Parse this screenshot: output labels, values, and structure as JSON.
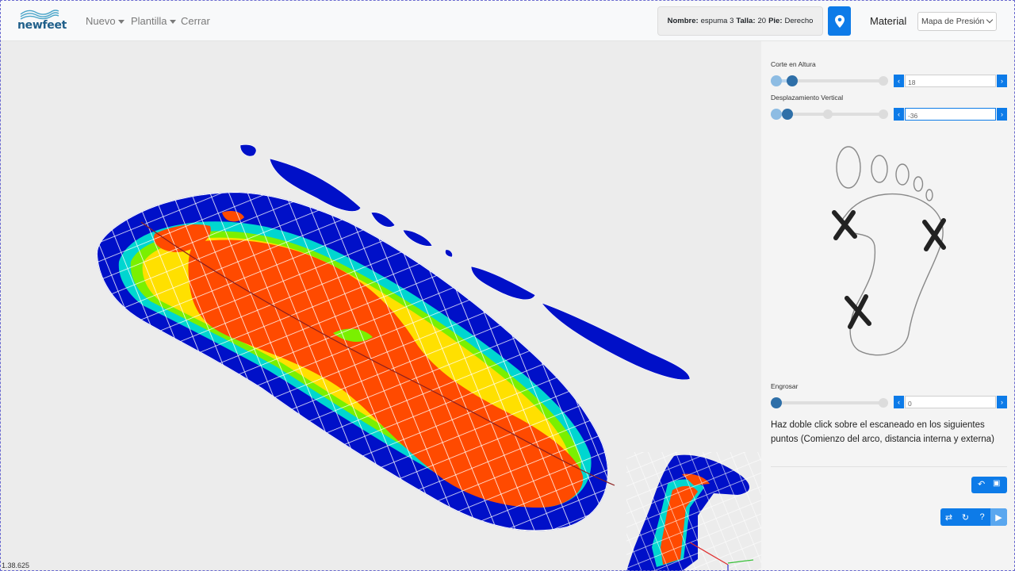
{
  "app": {
    "logo_text": "newfeet",
    "version": "1.38.625"
  },
  "nav": {
    "items": [
      {
        "label": "Nuevo"
      },
      {
        "label": "Plantilla"
      },
      {
        "label": "Cerrar"
      }
    ]
  },
  "info": {
    "nombre_label": "Nombre:",
    "nombre_value": "espuma 3",
    "talla_label": "Talla:",
    "talla_value": "20",
    "pie_label": "Pie:",
    "pie_value": "Derecho"
  },
  "material": {
    "label": "Material",
    "selected": "Mapa de Presión"
  },
  "controls": {
    "corte": {
      "label": "Corte en Altura",
      "value": "18"
    },
    "desplazamiento": {
      "label": "Desplazamiento Vertical",
      "value": "-36"
    },
    "engrosar": {
      "label": "Engrosar",
      "value": "0"
    }
  },
  "instruction": "Haz doble click sobre el escaneado en los siguientes puntos (Comienzo del arco, distancia interna y externa)",
  "colors": {
    "accent": "#0d7be8",
    "slider_dark": "#2e6fa8",
    "heat_high": "#ff4a00",
    "heat_low": "#0010c8"
  },
  "icons": [
    "logo-waves-icon",
    "map-pin-icon",
    "chevron-left-icon",
    "chevron-right-icon",
    "undo-icon",
    "save-icon",
    "swap-icon",
    "refresh-icon",
    "help-icon",
    "play-icon"
  ]
}
